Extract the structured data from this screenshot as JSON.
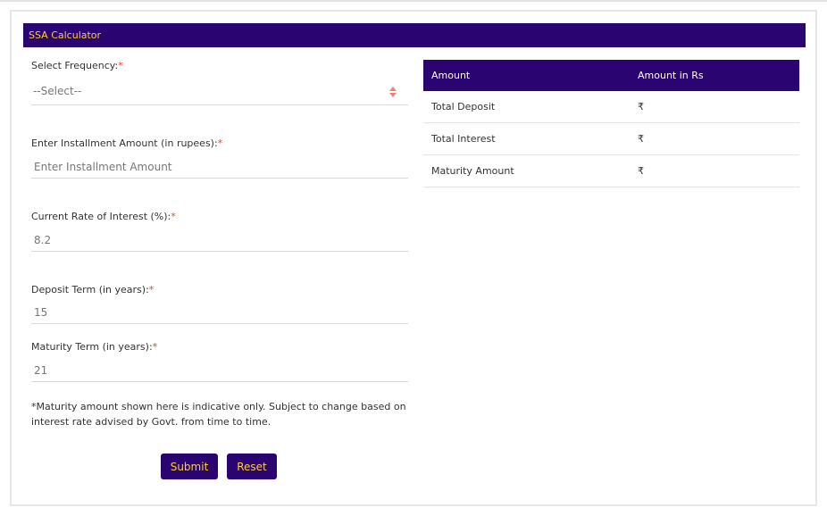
{
  "header": {
    "title": "SSA Calculator"
  },
  "form": {
    "frequency": {
      "label": "Select Frequency:",
      "required": "*",
      "selected": "--Select--"
    },
    "installment": {
      "label": "Enter Installment Amount (in rupees):",
      "required": "*",
      "placeholder": "Enter Installment Amount"
    },
    "interest": {
      "label": "Current Rate of Interest (%):",
      "required": "*",
      "value": "8.2"
    },
    "deposit_term": {
      "label": "Deposit Term (in years):",
      "required": "*",
      "value": "15"
    },
    "maturity_term": {
      "label": "Maturity Term (in years):",
      "required": "*",
      "value": "21"
    },
    "note": "*Maturity amount shown here is indicative only. Subject to change based on interest rate advised by Govt. from time to time.",
    "submit_label": "Submit",
    "reset_label": "Reset"
  },
  "results": {
    "headers": [
      "Amount",
      "Amount in Rs"
    ],
    "rows": [
      {
        "label": "Total Deposit",
        "value": "₹"
      },
      {
        "label": "Total Interest",
        "value": "₹"
      },
      {
        "label": "Maturity Amount",
        "value": "₹"
      }
    ]
  },
  "colors": {
    "brand": "#2a0470",
    "accent": "#ffcc33",
    "required": "#e0453a"
  },
  "icons": {
    "select_arrow": "sort-arrows-icon",
    "currency": "rupee-icon"
  }
}
